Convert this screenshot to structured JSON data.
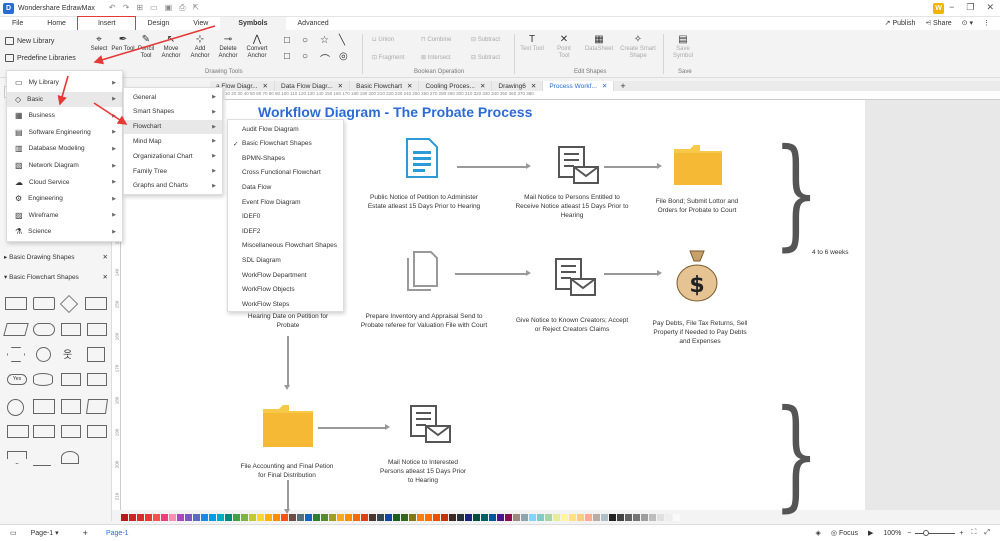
{
  "app": {
    "title": "Wondershare EdrawMax",
    "logo": "D",
    "user_initial": "W"
  },
  "menu": {
    "file": "File",
    "home": "Home",
    "insert": "Insert",
    "design": "Design",
    "view": "View",
    "symbols": "Symbols",
    "advanced": "Advanced",
    "publish": "Publish",
    "share": "Share"
  },
  "ribbon": {
    "new_library": "New Library",
    "predefine": "Predefine Libraries",
    "tools": [
      {
        "icon": "select-icon",
        "label": "Select"
      },
      {
        "icon": "pen-icon",
        "label": "Pen Tool"
      },
      {
        "icon": "pencil-icon",
        "label": "Pencil Tool"
      },
      {
        "icon": "move-anchor-icon",
        "label": "Move Anchor"
      },
      {
        "icon": "add-anchor-icon",
        "label": "Add Anchor"
      },
      {
        "icon": "delete-anchor-icon",
        "label": "Delete Anchor"
      },
      {
        "icon": "convert-anchor-icon",
        "label": "Convert Anchor"
      }
    ],
    "group_drawing": "Drawing Tools",
    "union": "Union",
    "combine": "Combine",
    "subtract": "Subtract",
    "fragment": "Fragment",
    "intersect": "Intersect",
    "subtract2": "Subtract",
    "group_boolean": "Boolean Operation",
    "text_tool": "Text Tool",
    "point_tool": "Point Tool",
    "datasheet": "DataSheet",
    "create_smart": "Create Smart Shape",
    "group_edit": "Edit Shapes",
    "save_symbol": "Save Symbol",
    "group_save": "Save"
  },
  "sidebar": {
    "basic_drawing": "Basic Drawing Shapes",
    "basic_flowchart": "Basic Flowchart Shapes",
    "yes": "Yes"
  },
  "menu_lib": {
    "items": [
      "My Library",
      "Basic",
      "Business",
      "Software Engineering",
      "Database Modeling",
      "Network Diagram",
      "Cloud Service",
      "Engineering",
      "Wireframe",
      "Science"
    ]
  },
  "menu_basic": {
    "items": [
      "General",
      "Smart Shapes",
      "Flowchart",
      "Mind Map",
      "Organizational Chart",
      "Family Tree",
      "Graphs and Charts"
    ]
  },
  "menu_flow": {
    "items": [
      "Audit Flow Diagram",
      "Basic Flowchart Shapes",
      "BPMN-Shapes",
      "Cross Functional Flowchart",
      "Data Flow",
      "Event Flow Diagram",
      "IDEF0",
      "IDEF2",
      "Miscellaneous Flowchart Shapes",
      "SDL Diagram",
      "WorkFlow Department",
      "WorkFlow Objects",
      "WorkFlow Steps"
    ],
    "check": "✓"
  },
  "tabs": [
    "a Flow Diagr...",
    "Data Flow Diagr...",
    "Basic Flowchart",
    "Cooling Proces...",
    "Drawing6",
    "Process Workf..."
  ],
  "ruler_top": "10   20   30   40   50   60   70   80   90   100   110   120   130   140   150   160   170   180   190   200   210   220   230   240   250   260   270   280   290   300   310   320   330   340   350   360   370   380",
  "ruler_left": [
    "90",
    "100",
    "110",
    "120",
    "130",
    "140",
    "150",
    "160",
    "170",
    "180",
    "190",
    "200",
    "210"
  ],
  "diagram": {
    "title": "Workflow Diagram - The Probate Process",
    "n1": "Public Notice of Petition to Administer Estate atleast 15 Days Prior to Hearing",
    "n2": "Mail Notice to Persons Entitled to Receive Notice atleast 15 Days Prior to Hearing",
    "n3": "File Bond; Submit Lottor and Orders for Probate to Court",
    "n4": "Hearing Date on Petition for Probate",
    "n5": "Prepare Inventory and Appraisal Send to Probate referee for Valuation File with Court",
    "n6": "Give Notice to Known Creators; Accept or Reject Creators Claims",
    "n7": "Pay Debts, File Tax Returns, Sell Property if Needed to Pay Debts and Expenses",
    "n8": "File Accounting and Final Petion for Final Distribution",
    "n9": "Mail Notice to Interested Persons atleast 15 Days Prior to Hearing",
    "weeks": "4 to 6 weeks",
    "dollar": "$"
  },
  "status": {
    "page_tab": "Page-1",
    "page_active": "Page-1",
    "focus": "Focus",
    "zoom": "100%",
    "add": "+"
  },
  "colors": {
    "accent": "#2b6bd6",
    "folder": "#f7c948",
    "red": "#e53935"
  }
}
